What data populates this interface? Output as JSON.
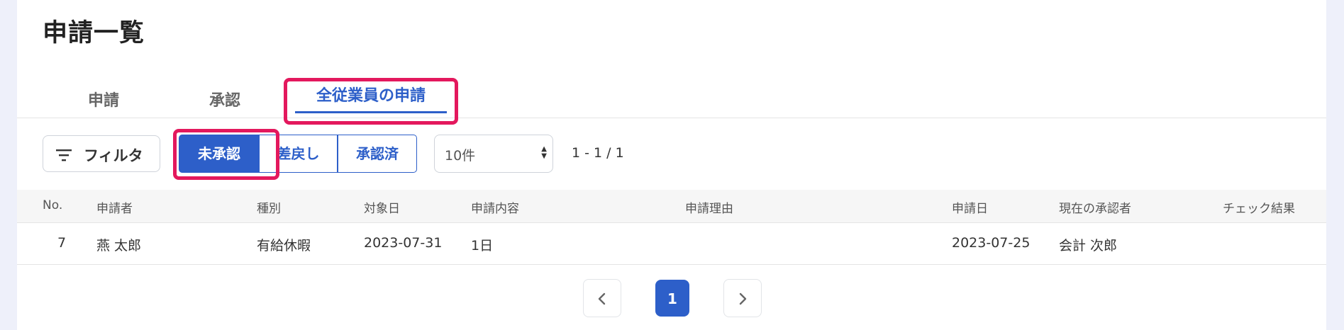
{
  "page": {
    "title": "申請一覧"
  },
  "tabs": [
    {
      "label": "申請"
    },
    {
      "label": "承認"
    },
    {
      "label": "全従業員の申請",
      "active": true
    }
  ],
  "toolbar": {
    "filter_label": "フィルタ",
    "filter_icon": "filter-lines-icon",
    "status_buttons": [
      "未承認",
      "差戻し",
      "承認済"
    ],
    "selected_status": "未承認",
    "page_size": "10件",
    "range_text": "1 - 1 / 1"
  },
  "table": {
    "headers": [
      "No.",
      "申請者",
      "種別",
      "対象日",
      "申請内容",
      "申請理由",
      "申請日",
      "現在の承認者",
      "チェック結果"
    ],
    "rows": [
      [
        "7",
        "燕 太郎",
        "有給休暇",
        "2023-07-31",
        "1日",
        "",
        "2023-07-25",
        "会計 次郎",
        ""
      ]
    ]
  },
  "pagination": {
    "current": "1"
  },
  "colors": {
    "accent": "#2d5fc9",
    "highlight": "#e3185d",
    "background": "#eef0fa"
  }
}
